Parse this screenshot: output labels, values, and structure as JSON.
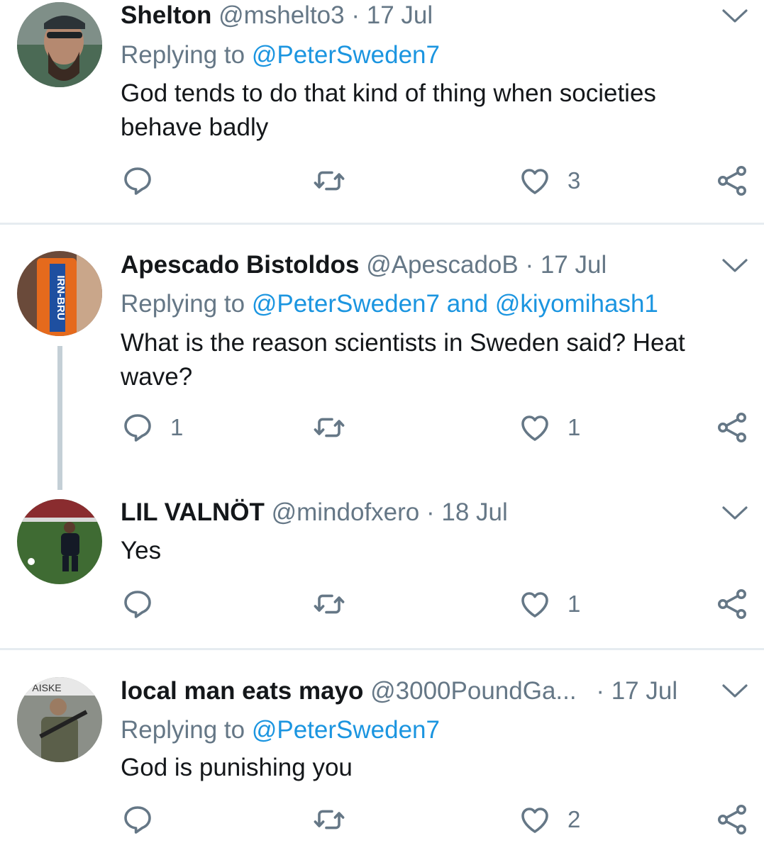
{
  "tweets": [
    {
      "name": "Shelton",
      "handle": "@mshelto3",
      "sep": "·",
      "date": "17 Jul",
      "replying_prefix": "Replying to",
      "replying_to": "@PeterSweden7",
      "text": "God tends to do that kind of thing when societies behave badly",
      "replies": "",
      "retweets": "",
      "likes": "3"
    },
    {
      "name": "Apescado Bistoldos",
      "handle": "@ApescadoB",
      "sep": "·",
      "date": "17 Jul",
      "replying_prefix": "Replying to",
      "replying_to": "@PeterSweden7 and @kiyomihash1",
      "text": "What is the reason scientists in Sweden said? Heat wave?",
      "replies": "1",
      "retweets": "",
      "likes": "1",
      "avatar_text": "IRN-BRU"
    },
    {
      "name": "LIL VALNÖT",
      "handle": "@mindofxero",
      "sep": "·",
      "date": "18 Jul",
      "text": "Yes",
      "replies": "",
      "retweets": "",
      "likes": "1"
    },
    {
      "name": "local man eats mayo",
      "handle": "@3000PoundGa...",
      "sep": "·",
      "date": "17 Jul",
      "replying_prefix": "Replying to",
      "replying_to": "@PeterSweden7",
      "text": "God is punishing you",
      "replies": "",
      "retweets": "",
      "likes": "2",
      "avatar_text": "AISKE"
    }
  ],
  "colors": {
    "text": "#14171a",
    "secondary": "#657786",
    "link": "#1b95e0",
    "divider": "#e6ecf0"
  },
  "icons": [
    "reply-icon",
    "retweet-icon",
    "like-icon",
    "share-icon",
    "chevron-down-icon"
  ]
}
